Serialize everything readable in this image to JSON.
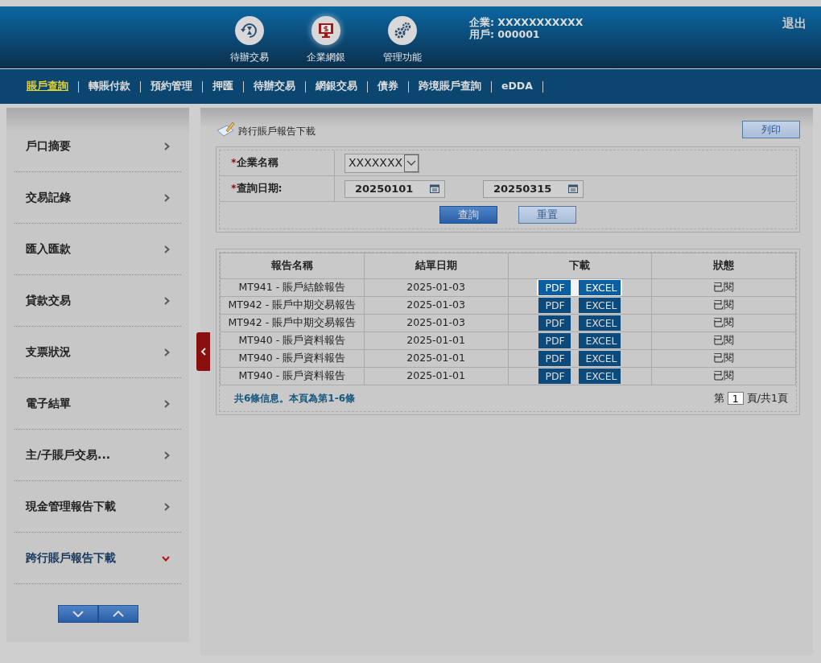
{
  "header": {
    "apps": [
      {
        "label": "待辦交易",
        "kind": "pending",
        "selected": false
      },
      {
        "label": "企業網銀",
        "kind": "bank",
        "selected": true
      },
      {
        "label": "管理功能",
        "kind": "manage",
        "selected": false
      }
    ],
    "company": "企業: XXXXXXXXXXX",
    "user": "用戶: 000001",
    "logout": "退出"
  },
  "nav": [
    {
      "label": "賬戶查詢",
      "selected": true
    },
    {
      "label": "轉賬付款",
      "selected": false
    },
    {
      "label": "預約管理",
      "selected": false
    },
    {
      "label": "押匯",
      "selected": false
    },
    {
      "label": "待辦交易",
      "selected": false
    },
    {
      "label": "網銀交易",
      "selected": false
    },
    {
      "label": "債券",
      "selected": false
    },
    {
      "label": "跨境賬戶查詢",
      "selected": false
    },
    {
      "label": "eDDA",
      "selected": false
    }
  ],
  "sidebar": {
    "items": [
      {
        "label": "戶口摘要",
        "expanded": false
      },
      {
        "label": "交易記錄",
        "expanded": false
      },
      {
        "label": "匯入匯款",
        "expanded": false
      },
      {
        "label": "貸款交易",
        "expanded": false
      },
      {
        "label": "支票狀況",
        "expanded": false
      },
      {
        "label": "電子結單",
        "expanded": false
      },
      {
        "label": "主/子賬戶交易...",
        "expanded": false
      },
      {
        "label": "現金管理報告下載",
        "expanded": false
      },
      {
        "label": "跨行賬戶報告下載",
        "expanded": true
      }
    ]
  },
  "page": {
    "title": "跨行賬戶報告下載",
    "print": "列印"
  },
  "form": {
    "company_required": "*",
    "company_label": "企業名稱",
    "date_required": "*",
    "company_value": "XXXXXXX",
    "date_label": "查詢日期:",
    "date_from": "20250101",
    "date_to": "20250315",
    "buttons": [
      {
        "label": "查詢",
        "kind": "primary"
      },
      {
        "label": "重置",
        "kind": "secondary"
      }
    ]
  },
  "table": {
    "columns": [
      "報告名稱",
      "結單日期",
      "下載",
      "狀態"
    ],
    "rows": [
      {
        "name": "MT941 - 賬戶結餘報告",
        "date": "2025-01-03",
        "downloads": [
          "PDF",
          "EXCEL"
        ],
        "highlighted": true,
        "status": "已閱"
      },
      {
        "name": "MT942 - 賬戶中期交易報告",
        "date": "2025-01-03",
        "downloads": [
          "PDF",
          "EXCEL"
        ],
        "highlighted": false,
        "status": "已閱"
      },
      {
        "name": "MT942 - 賬戶中期交易報告",
        "date": "2025-01-03",
        "downloads": [
          "PDF",
          "EXCEL"
        ],
        "highlighted": false,
        "status": "已閱"
      },
      {
        "name": "MT940 - 賬戶資料報告",
        "date": "2025-01-01",
        "downloads": [
          "PDF",
          "EXCEL"
        ],
        "highlighted": false,
        "status": "已閱"
      },
      {
        "name": "MT940 - 賬戶資料報告",
        "date": "2025-01-01",
        "downloads": [
          "PDF",
          "EXCEL"
        ],
        "highlighted": false,
        "status": "已閱"
      },
      {
        "name": "MT940 - 賬戶資料報告",
        "date": "2025-01-01",
        "downloads": [
          "PDF",
          "EXCEL"
        ],
        "highlighted": false,
        "status": "已閱"
      }
    ],
    "summary": "共**6**條信息。本頁為第**1-6**條",
    "page_prefix": "第",
    "page_value": "1",
    "page_suffix": "頁/共1頁"
  }
}
